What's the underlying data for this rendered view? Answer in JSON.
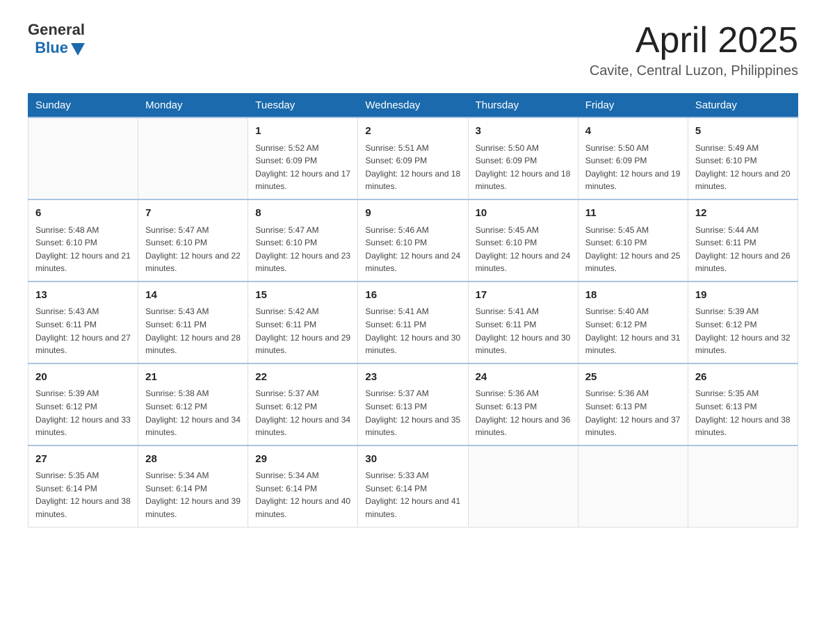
{
  "header": {
    "logo": {
      "general": "General",
      "blue": "Blue"
    },
    "title": "April 2025",
    "subtitle": "Cavite, Central Luzon, Philippines"
  },
  "days_of_week": [
    "Sunday",
    "Monday",
    "Tuesday",
    "Wednesday",
    "Thursday",
    "Friday",
    "Saturday"
  ],
  "weeks": [
    [
      {
        "day": "",
        "sunrise": "",
        "sunset": "",
        "daylight": ""
      },
      {
        "day": "",
        "sunrise": "",
        "sunset": "",
        "daylight": ""
      },
      {
        "day": "1",
        "sunrise": "Sunrise: 5:52 AM",
        "sunset": "Sunset: 6:09 PM",
        "daylight": "Daylight: 12 hours and 17 minutes."
      },
      {
        "day": "2",
        "sunrise": "Sunrise: 5:51 AM",
        "sunset": "Sunset: 6:09 PM",
        "daylight": "Daylight: 12 hours and 18 minutes."
      },
      {
        "day": "3",
        "sunrise": "Sunrise: 5:50 AM",
        "sunset": "Sunset: 6:09 PM",
        "daylight": "Daylight: 12 hours and 18 minutes."
      },
      {
        "day": "4",
        "sunrise": "Sunrise: 5:50 AM",
        "sunset": "Sunset: 6:09 PM",
        "daylight": "Daylight: 12 hours and 19 minutes."
      },
      {
        "day": "5",
        "sunrise": "Sunrise: 5:49 AM",
        "sunset": "Sunset: 6:10 PM",
        "daylight": "Daylight: 12 hours and 20 minutes."
      }
    ],
    [
      {
        "day": "6",
        "sunrise": "Sunrise: 5:48 AM",
        "sunset": "Sunset: 6:10 PM",
        "daylight": "Daylight: 12 hours and 21 minutes."
      },
      {
        "day": "7",
        "sunrise": "Sunrise: 5:47 AM",
        "sunset": "Sunset: 6:10 PM",
        "daylight": "Daylight: 12 hours and 22 minutes."
      },
      {
        "day": "8",
        "sunrise": "Sunrise: 5:47 AM",
        "sunset": "Sunset: 6:10 PM",
        "daylight": "Daylight: 12 hours and 23 minutes."
      },
      {
        "day": "9",
        "sunrise": "Sunrise: 5:46 AM",
        "sunset": "Sunset: 6:10 PM",
        "daylight": "Daylight: 12 hours and 24 minutes."
      },
      {
        "day": "10",
        "sunrise": "Sunrise: 5:45 AM",
        "sunset": "Sunset: 6:10 PM",
        "daylight": "Daylight: 12 hours and 24 minutes."
      },
      {
        "day": "11",
        "sunrise": "Sunrise: 5:45 AM",
        "sunset": "Sunset: 6:10 PM",
        "daylight": "Daylight: 12 hours and 25 minutes."
      },
      {
        "day": "12",
        "sunrise": "Sunrise: 5:44 AM",
        "sunset": "Sunset: 6:11 PM",
        "daylight": "Daylight: 12 hours and 26 minutes."
      }
    ],
    [
      {
        "day": "13",
        "sunrise": "Sunrise: 5:43 AM",
        "sunset": "Sunset: 6:11 PM",
        "daylight": "Daylight: 12 hours and 27 minutes."
      },
      {
        "day": "14",
        "sunrise": "Sunrise: 5:43 AM",
        "sunset": "Sunset: 6:11 PM",
        "daylight": "Daylight: 12 hours and 28 minutes."
      },
      {
        "day": "15",
        "sunrise": "Sunrise: 5:42 AM",
        "sunset": "Sunset: 6:11 PM",
        "daylight": "Daylight: 12 hours and 29 minutes."
      },
      {
        "day": "16",
        "sunrise": "Sunrise: 5:41 AM",
        "sunset": "Sunset: 6:11 PM",
        "daylight": "Daylight: 12 hours and 30 minutes."
      },
      {
        "day": "17",
        "sunrise": "Sunrise: 5:41 AM",
        "sunset": "Sunset: 6:11 PM",
        "daylight": "Daylight: 12 hours and 30 minutes."
      },
      {
        "day": "18",
        "sunrise": "Sunrise: 5:40 AM",
        "sunset": "Sunset: 6:12 PM",
        "daylight": "Daylight: 12 hours and 31 minutes."
      },
      {
        "day": "19",
        "sunrise": "Sunrise: 5:39 AM",
        "sunset": "Sunset: 6:12 PM",
        "daylight": "Daylight: 12 hours and 32 minutes."
      }
    ],
    [
      {
        "day": "20",
        "sunrise": "Sunrise: 5:39 AM",
        "sunset": "Sunset: 6:12 PM",
        "daylight": "Daylight: 12 hours and 33 minutes."
      },
      {
        "day": "21",
        "sunrise": "Sunrise: 5:38 AM",
        "sunset": "Sunset: 6:12 PM",
        "daylight": "Daylight: 12 hours and 34 minutes."
      },
      {
        "day": "22",
        "sunrise": "Sunrise: 5:37 AM",
        "sunset": "Sunset: 6:12 PM",
        "daylight": "Daylight: 12 hours and 34 minutes."
      },
      {
        "day": "23",
        "sunrise": "Sunrise: 5:37 AM",
        "sunset": "Sunset: 6:13 PM",
        "daylight": "Daylight: 12 hours and 35 minutes."
      },
      {
        "day": "24",
        "sunrise": "Sunrise: 5:36 AM",
        "sunset": "Sunset: 6:13 PM",
        "daylight": "Daylight: 12 hours and 36 minutes."
      },
      {
        "day": "25",
        "sunrise": "Sunrise: 5:36 AM",
        "sunset": "Sunset: 6:13 PM",
        "daylight": "Daylight: 12 hours and 37 minutes."
      },
      {
        "day": "26",
        "sunrise": "Sunrise: 5:35 AM",
        "sunset": "Sunset: 6:13 PM",
        "daylight": "Daylight: 12 hours and 38 minutes."
      }
    ],
    [
      {
        "day": "27",
        "sunrise": "Sunrise: 5:35 AM",
        "sunset": "Sunset: 6:14 PM",
        "daylight": "Daylight: 12 hours and 38 minutes."
      },
      {
        "day": "28",
        "sunrise": "Sunrise: 5:34 AM",
        "sunset": "Sunset: 6:14 PM",
        "daylight": "Daylight: 12 hours and 39 minutes."
      },
      {
        "day": "29",
        "sunrise": "Sunrise: 5:34 AM",
        "sunset": "Sunset: 6:14 PM",
        "daylight": "Daylight: 12 hours and 40 minutes."
      },
      {
        "day": "30",
        "sunrise": "Sunrise: 5:33 AM",
        "sunset": "Sunset: 6:14 PM",
        "daylight": "Daylight: 12 hours and 41 minutes."
      },
      {
        "day": "",
        "sunrise": "",
        "sunset": "",
        "daylight": ""
      },
      {
        "day": "",
        "sunrise": "",
        "sunset": "",
        "daylight": ""
      },
      {
        "day": "",
        "sunrise": "",
        "sunset": "",
        "daylight": ""
      }
    ]
  ]
}
